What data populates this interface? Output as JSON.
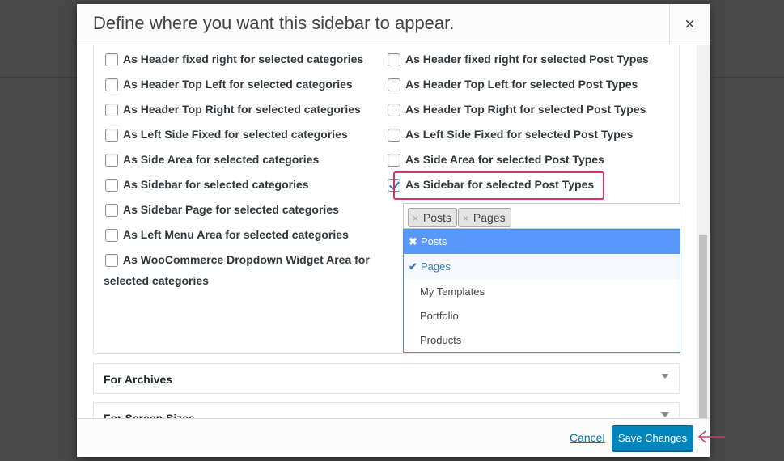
{
  "modal": {
    "title": "Define where you want this sidebar to appear.",
    "close_glyph": "×"
  },
  "left_column": [
    {
      "label": "As Header fixed right for selected categories",
      "checked": false
    },
    {
      "label": "As Header Top Left for selected categories",
      "checked": false
    },
    {
      "label": "As Header Top Right for selected categories",
      "checked": false
    },
    {
      "label": "As Left Side Fixed for selected categories",
      "checked": false
    },
    {
      "label": "As Side Area for selected categories",
      "checked": false
    },
    {
      "label": "As Sidebar for selected categories",
      "checked": false
    },
    {
      "label": "As Sidebar Page for selected categories",
      "checked": false
    },
    {
      "label": "As Left Menu Area for selected categories",
      "checked": false
    },
    {
      "label": "As WooCommerce Dropdown Widget Area for",
      "label_line2": "selected categories",
      "checked": false
    }
  ],
  "right_column": [
    {
      "label": "As Header fixed right for selected Post Types",
      "checked": false
    },
    {
      "label": "As Header Top Left for selected Post Types",
      "checked": false
    },
    {
      "label": "As Header Top Right for selected Post Types",
      "checked": false
    },
    {
      "label": "As Left Side Fixed for selected Post Types",
      "checked": false
    },
    {
      "label": "As Side Area for selected Post Types",
      "checked": false
    },
    {
      "label": "As Sidebar for selected Post Types",
      "checked": true
    }
  ],
  "post_type_select": {
    "tags": [
      {
        "remove_glyph": "×",
        "label": "Posts"
      },
      {
        "remove_glyph": "×",
        "label": "Pages"
      }
    ],
    "options": [
      {
        "label": "Posts",
        "mark": "✖",
        "state": "active"
      },
      {
        "label": "Pages",
        "mark": "✔",
        "state": "selected"
      },
      {
        "label": "My Templates",
        "mark": "",
        "state": "normal"
      },
      {
        "label": "Portfolio",
        "mark": "",
        "state": "normal"
      },
      {
        "label": "Products",
        "mark": "",
        "state": "normal"
      }
    ]
  },
  "accordions": [
    {
      "label": "For Archives"
    },
    {
      "label": "For Screen Sizes"
    }
  ],
  "footer": {
    "cancel_label": "Cancel",
    "save_label": "Save Changes"
  },
  "colors": {
    "highlight": "#d6336c",
    "primary_button": "#0085ba",
    "dropdown_active": "#5897fb",
    "link": "#0073aa"
  }
}
